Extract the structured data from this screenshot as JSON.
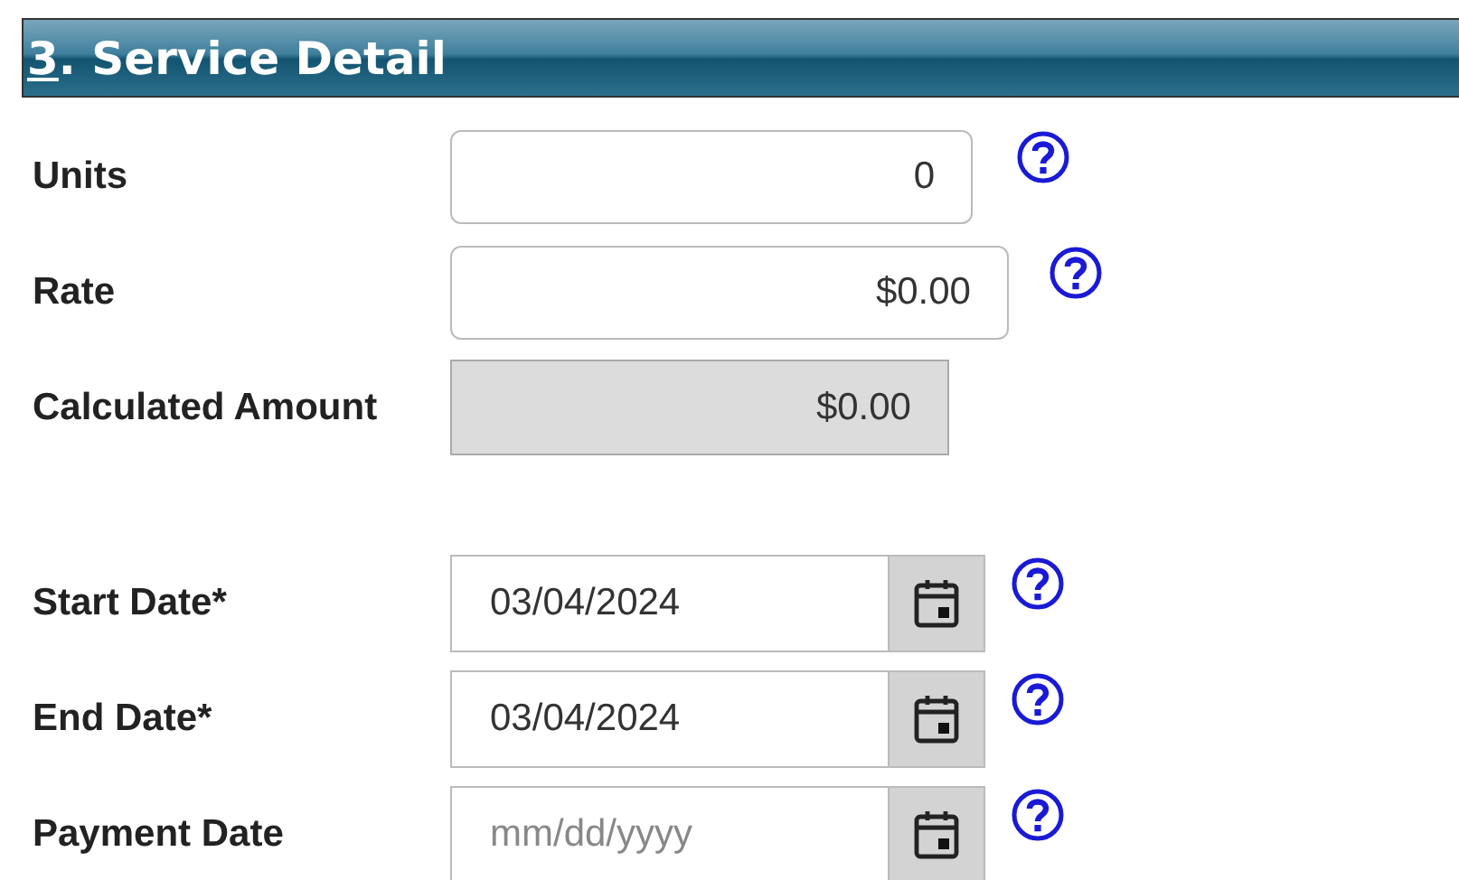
{
  "section": {
    "title": "3. Service Detail",
    "access_key_underlined": true
  },
  "fields": [
    {
      "kind": "input",
      "label": "Units",
      "value": "0",
      "help": true
    },
    {
      "kind": "input",
      "label": "Rate",
      "value": "$0.00",
      "help": true
    },
    {
      "kind": "readonly",
      "label": "Calculated Amount",
      "value": "$0.00",
      "help": false
    },
    {
      "kind": "date",
      "label": "Start Date*",
      "value": "03/04/2024",
      "help": true
    },
    {
      "kind": "date",
      "label": "End Date*",
      "value": "03/04/2024",
      "help": true
    },
    {
      "kind": "date",
      "label": "Payment Date",
      "placeholder": "mm/dd/yyyy",
      "help": true
    }
  ]
}
